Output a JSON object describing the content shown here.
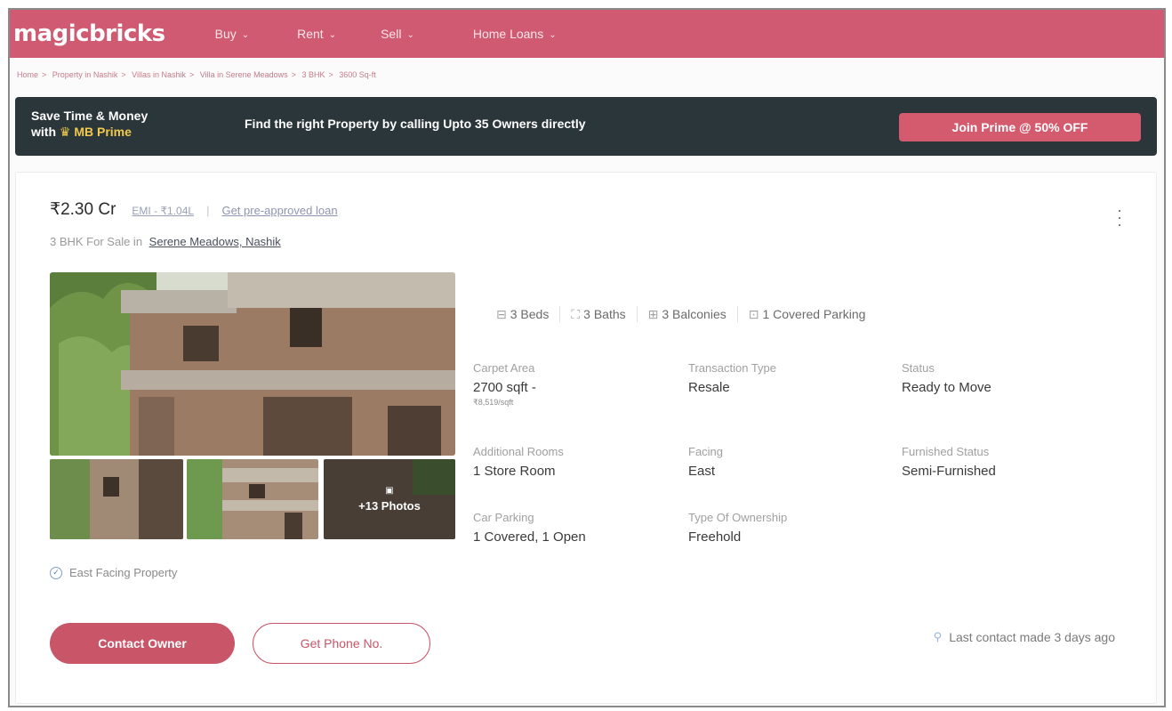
{
  "nav": {
    "logo": "magicbricks",
    "items": [
      {
        "label": "Buy"
      },
      {
        "label": "Rent"
      },
      {
        "label": "Sell"
      },
      {
        "label": "Home Loans"
      }
    ]
  },
  "breadcrumb": [
    "Home",
    "Property in Nashik",
    "Villas in Nashik",
    "Villa in Serene Meadows",
    "3 BHK",
    "3600 Sq-ft"
  ],
  "prime": {
    "line1": "Save Time & Money",
    "line2_prefix": "with",
    "line2_brand": "MB Prime",
    "message": "Find the right Property by calling Upto 35 Owners directly",
    "cta": "Join Prime @ 50% OFF"
  },
  "listing": {
    "price": "₹2.30 Cr",
    "emi": "EMI - ₹1.04L",
    "loan_link": "Get pre-approved loan",
    "subtitle_prefix": "3 BHK For Sale in",
    "location": "Serene Meadows, Nashik",
    "more_photos": "+13 Photos",
    "amenities": [
      {
        "label": "3 Beds",
        "icon": "bed-icon"
      },
      {
        "label": "3 Baths",
        "icon": "bath-icon"
      },
      {
        "label": "3 Balconies",
        "icon": "balcony-icon"
      },
      {
        "label": "1 Covered Parking",
        "icon": "parking-icon"
      }
    ],
    "details": {
      "carpet_area": {
        "label": "Carpet Area",
        "value": "2700 sqft -",
        "sub": "₹8,519/sqft"
      },
      "transaction_type": {
        "label": "Transaction Type",
        "value": "Resale"
      },
      "status": {
        "label": "Status",
        "value": "Ready to Move"
      },
      "additional_rooms": {
        "label": "Additional Rooms",
        "value": "1 Store Room"
      },
      "facing": {
        "label": "Facing",
        "value": "East"
      },
      "furnished": {
        "label": "Furnished Status",
        "value": "Semi-Furnished"
      },
      "car_parking": {
        "label": "Car Parking",
        "value": "1 Covered, 1 Open"
      },
      "ownership": {
        "label": "Type Of Ownership",
        "value": "Freehold"
      }
    },
    "tag": "East Facing Property",
    "contact_button": "Contact Owner",
    "phone_button": "Get Phone No.",
    "last_contact": "Last contact made 3 days ago"
  },
  "colors": {
    "brand": "#cf5a71",
    "prime_bg": "#2b363a",
    "cta": "#d45b6e"
  }
}
